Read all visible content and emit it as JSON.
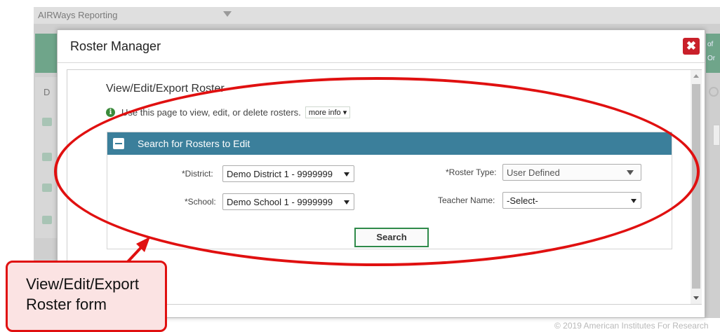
{
  "background": {
    "app_title": "AIRWays Reporting",
    "side_letter": "D",
    "right_edge_text": "of Or",
    "footer": "© 2019 American Institutes For Research"
  },
  "modal": {
    "title": "Roster Manager",
    "close_icon": "close-icon",
    "section_title": "View/Edit/Export Roster",
    "info_text": "Use this page to view, edit, or delete rosters.",
    "more_info_label": "more info ▾",
    "form": {
      "header": "Search for Rosters to Edit",
      "district_label": "*District:",
      "district_value": "Demo District 1 - 9999999",
      "school_label": "*School:",
      "school_value": "Demo School 1 - 9999999",
      "roster_type_label": "*Roster Type:",
      "roster_type_value": "User Defined",
      "teacher_label": "Teacher Name:",
      "teacher_value": "-Select-",
      "search_label": "Search"
    }
  },
  "annotation": {
    "callout_line1": "View/Edit/Export",
    "callout_line2": "Roster form",
    "color": "#e01010"
  },
  "colors": {
    "header_bar": "#3b7f9b",
    "close_button": "#c9202a",
    "search_border": "#2f8a4a"
  }
}
